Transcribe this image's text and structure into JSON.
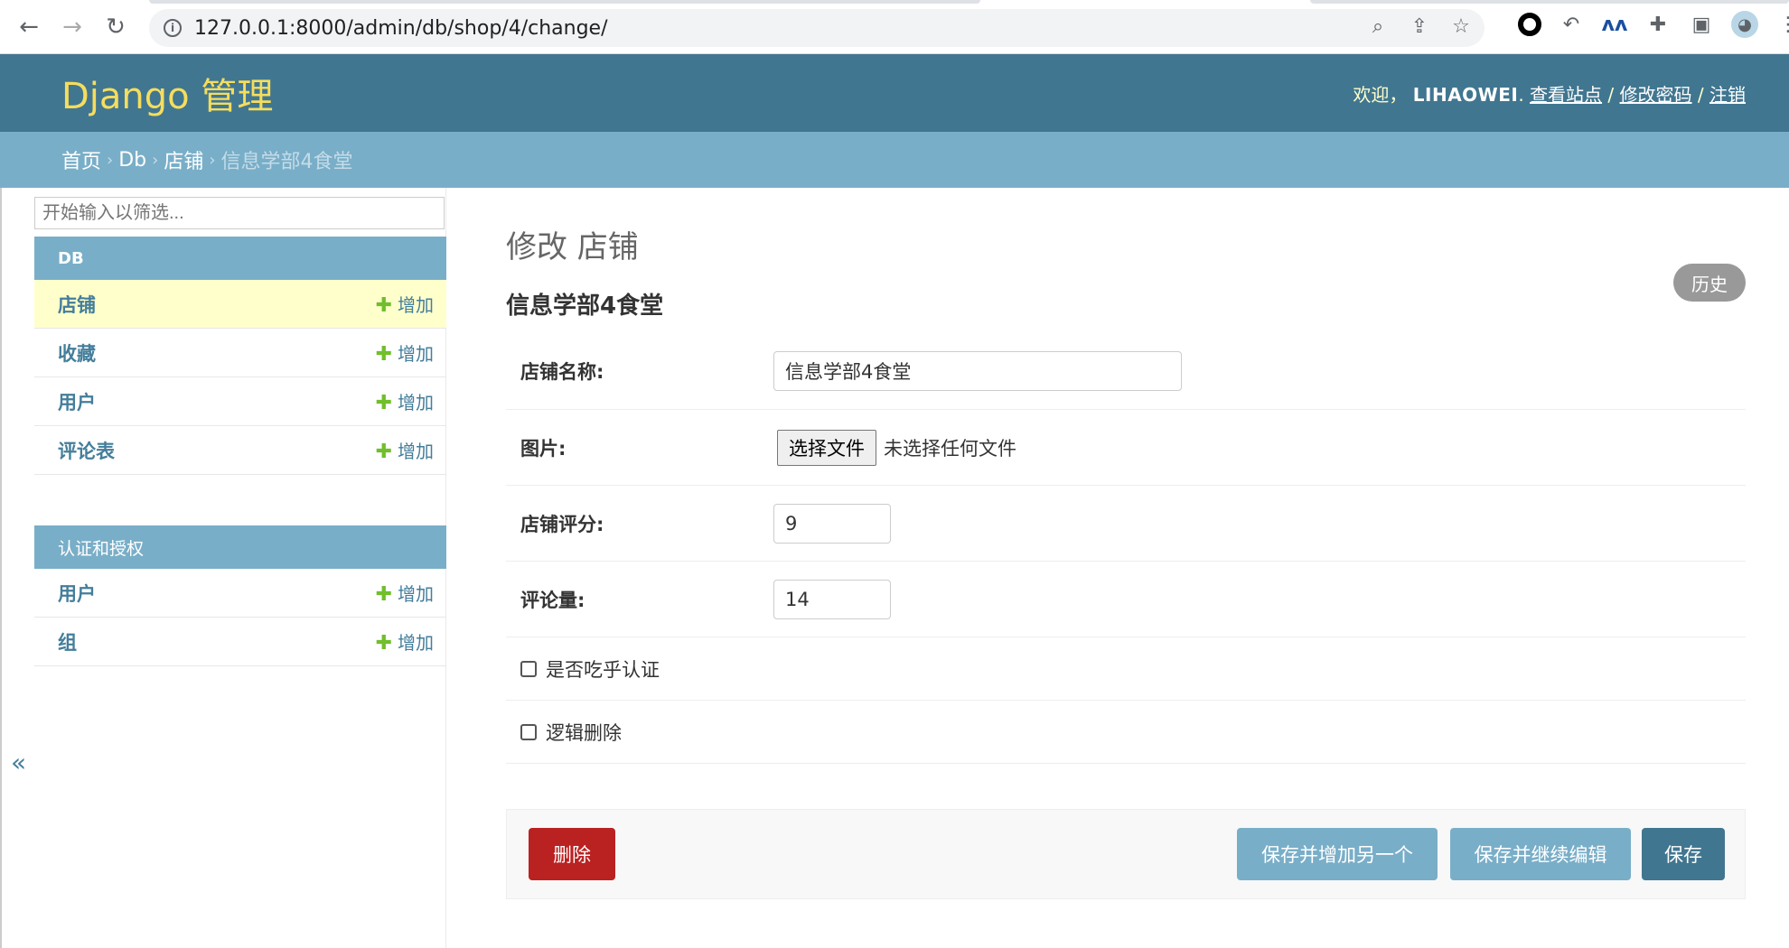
{
  "browser": {
    "url": "127.0.0.1:8000/admin/db/shop/4/change/"
  },
  "header": {
    "brand": "Django 管理",
    "welcome": "欢迎，",
    "username": "LIHAOWEI",
    "dot": ".",
    "view_site": "查看站点",
    "change_password": "修改密码",
    "logout": "注销",
    "slash": "/"
  },
  "breadcrumbs": {
    "home": "首页",
    "app": "Db",
    "model": "店铺",
    "current": "信息学部4食堂",
    "sep": "›"
  },
  "sidebar": {
    "filter_placeholder": "开始输入以筛选...",
    "add_label": "增加",
    "db_caption": "DB",
    "db_items": [
      {
        "label": "店铺"
      },
      {
        "label": "收藏"
      },
      {
        "label": "用户"
      },
      {
        "label": "评论表"
      }
    ],
    "auth_caption": "认证和授权",
    "auth_items": [
      {
        "label": "用户"
      },
      {
        "label": "组"
      }
    ],
    "collapse": "«"
  },
  "content": {
    "title": "修改 店铺",
    "history": "历史",
    "object_title": "信息学部4食堂",
    "fields": {
      "name_label": "店铺名称:",
      "name_value": "信息学部4食堂",
      "image_label": "图片:",
      "file_button": "选择文件",
      "file_status": "未选择任何文件",
      "rating_label": "店铺评分:",
      "rating_value": "9",
      "comments_label": "评论量:",
      "comments_value": "14",
      "certified_label": "是否吃乎认证",
      "deleted_label": "逻辑删除"
    },
    "buttons": {
      "delete": "删除",
      "save_add_another": "保存并增加另一个",
      "save_continue": "保存并继续编辑",
      "save": "保存"
    }
  }
}
